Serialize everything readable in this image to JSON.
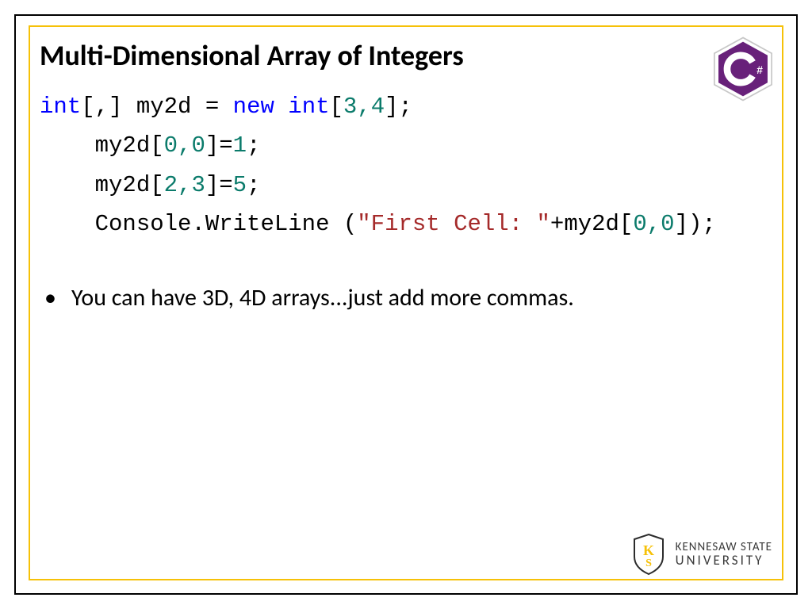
{
  "title": "Multi-Dimensional Array of Integers",
  "code": {
    "line1": {
      "t_int": "int",
      "br1": "[",
      "c1": ",",
      "br2": "]",
      "var": " my2d = ",
      "t_new": "new",
      "sp": " ",
      "t_int2": "int",
      "br3": "[",
      "n3": "3",
      "c2": ",",
      "n4": "4",
      "br4": "];"
    },
    "line2": {
      "indent": "    ",
      "pre": "my2d[",
      "n0": "0",
      "c": ",",
      "n00": "0",
      "post": "]=",
      "v": "1",
      "semi": ";"
    },
    "line3": {
      "indent": "    ",
      "pre": "my2d[",
      "n2": "2",
      "c": ",",
      "n3": "3",
      "post": "]=",
      "v": "5",
      "semi": ";"
    },
    "line4": {
      "indent": "    ",
      "call": "Console.WriteLine (",
      "str": "\"First Cell: \"",
      "plus": "+my2d[",
      "n0": "0",
      "c": ",",
      "n00": "0",
      "end": "]);"
    }
  },
  "bullet": "You can have 3D, 4D arrays...just add more commas.",
  "logos": {
    "csharp": "C#",
    "ksu_top": "KENNESAW STATE",
    "ksu_bot": "UNIVERSITY"
  }
}
